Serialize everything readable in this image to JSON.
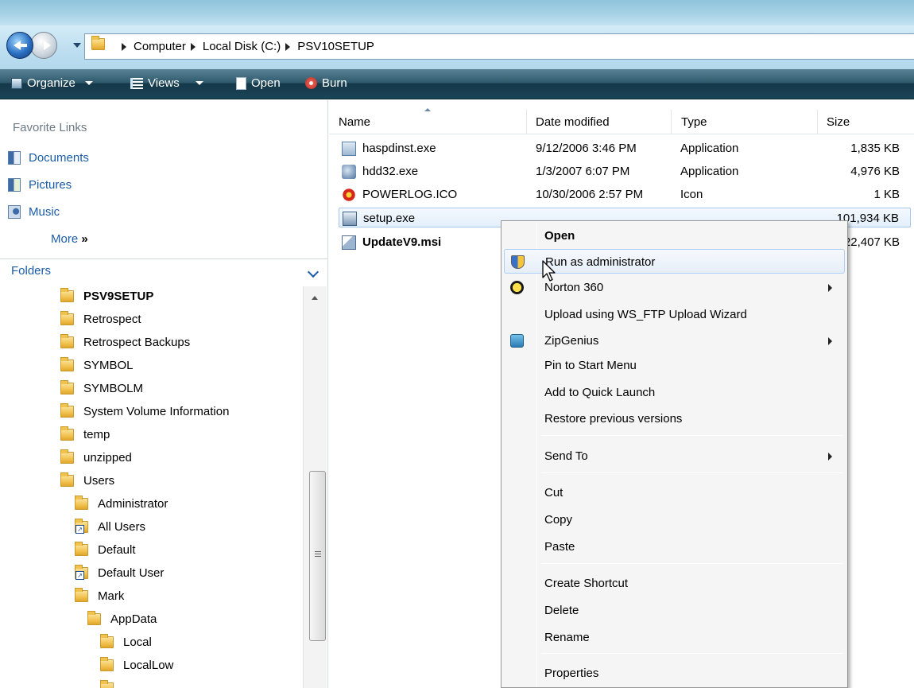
{
  "address_bar": {
    "crumbs": [
      "Computer",
      "Local Disk (C:)",
      "PSV10SETUP"
    ]
  },
  "toolbar": {
    "organize_label": "Organize",
    "views_label": "Views",
    "open_label": "Open",
    "burn_label": "Burn"
  },
  "nav_pane": {
    "favorites_header": "Favorite Links",
    "favorites": [
      {
        "label": "Documents",
        "icon": "documents-icon"
      },
      {
        "label": "Pictures",
        "icon": "pictures-icon"
      },
      {
        "label": "Music",
        "icon": "music-icon"
      }
    ],
    "more_label": "More",
    "more_glyph": "»",
    "folders_header": "Folders",
    "tree": [
      {
        "label": "PSV9SETUP",
        "level": 0,
        "bold": true
      },
      {
        "label": "Retrospect",
        "level": 0
      },
      {
        "label": "Retrospect Backups",
        "level": 0
      },
      {
        "label": "SYMBOL",
        "level": 0
      },
      {
        "label": "SYMBOLM",
        "level": 0
      },
      {
        "label": "System Volume Information",
        "level": 0
      },
      {
        "label": "temp",
        "level": 0
      },
      {
        "label": "unzipped",
        "level": 0
      },
      {
        "label": "Users",
        "level": 0
      },
      {
        "label": "Administrator",
        "level": 1
      },
      {
        "label": "All Users",
        "level": 1,
        "shortcut": true
      },
      {
        "label": "Default",
        "level": 1
      },
      {
        "label": "Default User",
        "level": 1,
        "shortcut": true
      },
      {
        "label": "Mark",
        "level": 1
      },
      {
        "label": "AppData",
        "level": 2
      },
      {
        "label": "Local",
        "level": 3
      },
      {
        "label": "LocalLow",
        "level": 3
      }
    ]
  },
  "file_list": {
    "columns": [
      "Name",
      "Date modified",
      "Type",
      "Size"
    ],
    "rows": [
      {
        "name": "haspdinst.exe",
        "date": "9/12/2006 3:46 PM",
        "type": "Application",
        "size": "1,835 KB",
        "icon": "application-icon"
      },
      {
        "name": "hdd32.exe",
        "date": "1/3/2007 6:07 PM",
        "type": "Application",
        "size": "4,976 KB",
        "icon": "application-icon"
      },
      {
        "name": "POWERLOG.ICO",
        "date": "10/30/2006 2:57 PM",
        "type": "Icon",
        "size": "1 KB",
        "icon": "powerlog-icon"
      },
      {
        "name": "setup.exe",
        "date": "",
        "type": "",
        "size": "101,934 KB",
        "icon": "setup-icon",
        "selected": true
      },
      {
        "name": "UpdateV9.msi",
        "date": "",
        "type": "",
        "size": "22,407 KB",
        "icon": "installer-icon",
        "bold": true
      }
    ]
  },
  "context_menu": {
    "items": [
      {
        "label": "Open",
        "bold": true
      },
      {
        "label": "Run as administrator",
        "icon": "uac-shield-icon",
        "hover": true
      },
      {
        "label": "Norton 360",
        "icon": "norton-icon",
        "submenu": true
      },
      {
        "label": "Upload using WS_FTP Upload Wizard"
      },
      {
        "label": "ZipGenius",
        "icon": "zipgenius-icon",
        "submenu": true
      },
      {
        "label": "Pin to Start Menu"
      },
      {
        "label": "Add to Quick Launch"
      },
      {
        "label": "Restore previous versions"
      },
      {
        "label": "Send To",
        "submenu": true
      },
      {
        "label": "Cut"
      },
      {
        "label": "Copy"
      },
      {
        "label": "Paste"
      },
      {
        "label": "Create Shortcut"
      },
      {
        "label": "Delete"
      },
      {
        "label": "Rename"
      },
      {
        "label": "Properties"
      }
    ]
  },
  "colors": {
    "link_blue": "#1b5ca8",
    "toolbar_dark": "#143849",
    "hover_border": "#aecff7"
  }
}
